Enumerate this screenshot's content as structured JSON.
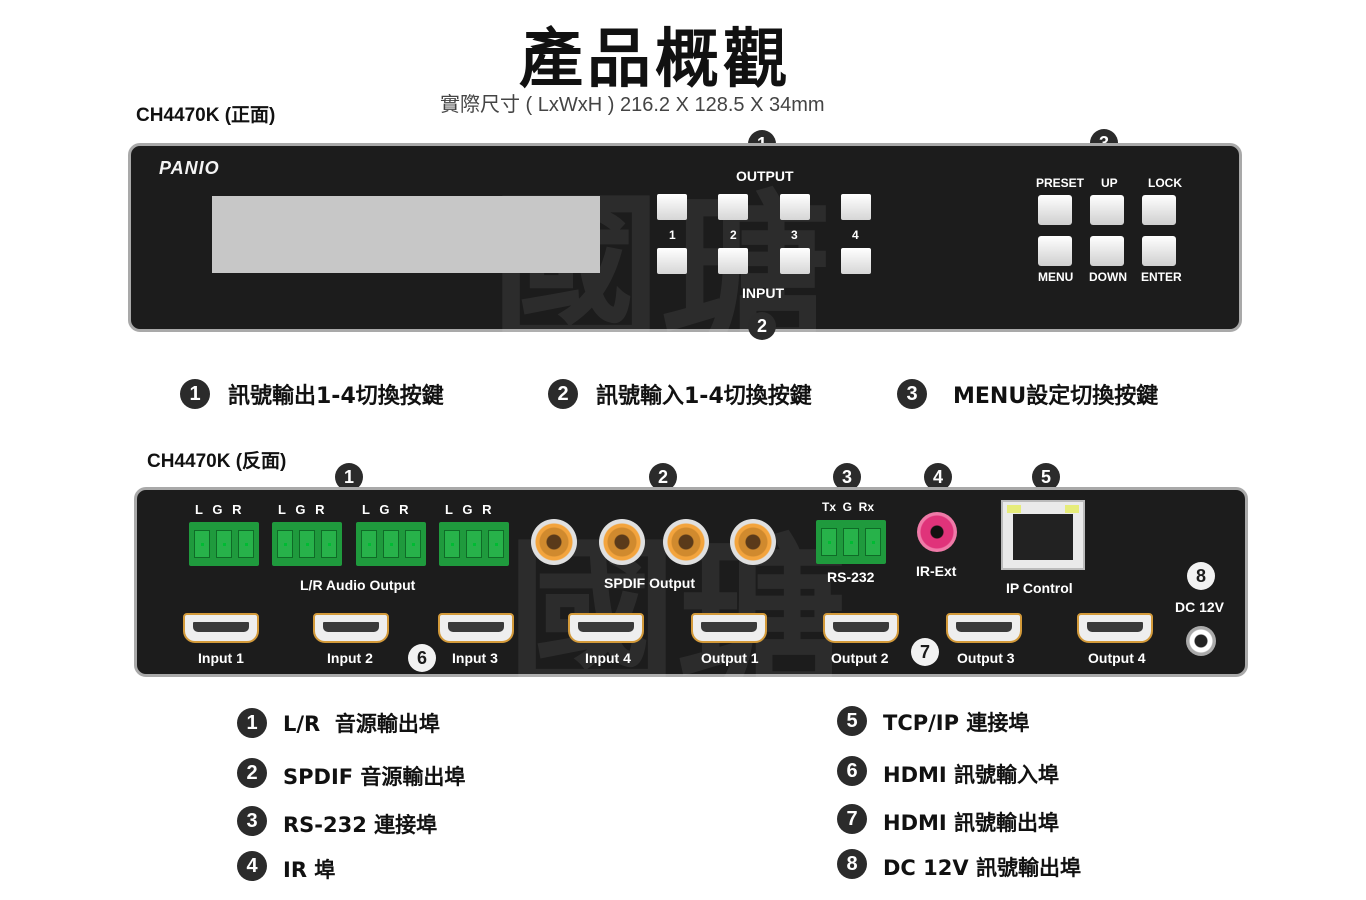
{
  "header": {
    "title": "產品概觀",
    "subtitle": "實際尺寸 ( LxWxH ) 216.2 X 128.5 X 34mm"
  },
  "front": {
    "section_label": "CH4470K (正面)",
    "logo": "PANIO",
    "output_label": "OUTPUT",
    "input_label": "INPUT",
    "channel_numbers": [
      "1",
      "2",
      "3",
      "4"
    ],
    "menu_top_labels": [
      "PRESET",
      "UP",
      "LOCK"
    ],
    "menu_bottom_labels": [
      "MENU",
      "DOWN",
      "ENTER"
    ],
    "badges": [
      "1",
      "2",
      "3"
    ],
    "legend": [
      {
        "num": "1",
        "text": "訊號輸出1-4切換按鍵"
      },
      {
        "num": "2",
        "text": "訊號輸入1-4切換按鍵"
      },
      {
        "num": "3",
        "text": "MENU設定切換按鍵"
      }
    ]
  },
  "rear": {
    "section_label": "CH4470K (反面)",
    "lgr_labels": [
      "L",
      "G",
      "R"
    ],
    "audio_output_label": "L/R Audio Output",
    "spdif_label": "SPDIF Output",
    "rs232_pins": "Tx  G  Rx",
    "rs232_label": "RS-232",
    "ir_label": "IR-Ext",
    "ip_label": "IP Control",
    "dc_label": "DC 12V",
    "hdmi_labels": [
      "Input 1",
      "Input 2",
      "Input 3",
      "Input 4",
      "Output 1",
      "Output 2",
      "Output 3",
      "Output 4"
    ],
    "badges": [
      "1",
      "2",
      "3",
      "4",
      "5",
      "6",
      "7",
      "8"
    ],
    "legend_left": [
      {
        "num": "1",
        "text": "L/R  音源輸出埠"
      },
      {
        "num": "2",
        "text": "SPDIF 音源輸出埠"
      },
      {
        "num": "3",
        "text": "RS-232 連接埠"
      },
      {
        "num": "4",
        "text": "IR 埠"
      }
    ],
    "legend_right": [
      {
        "num": "5",
        "text": "TCP/IP 連接埠"
      },
      {
        "num": "6",
        "text": "HDMI 訊號輸入埠"
      },
      {
        "num": "7",
        "text": "HDMI 訊號輸出埠"
      },
      {
        "num": "8",
        "text": "DC 12V 訊號輸出埠"
      }
    ]
  },
  "colors": {
    "panel": "#1c1c1c",
    "terminal_green": "#1f9a3d",
    "rca_gold": "#f3a43d",
    "ir_pink": "#e0337a",
    "hdmi_border": "#d39a3a"
  }
}
